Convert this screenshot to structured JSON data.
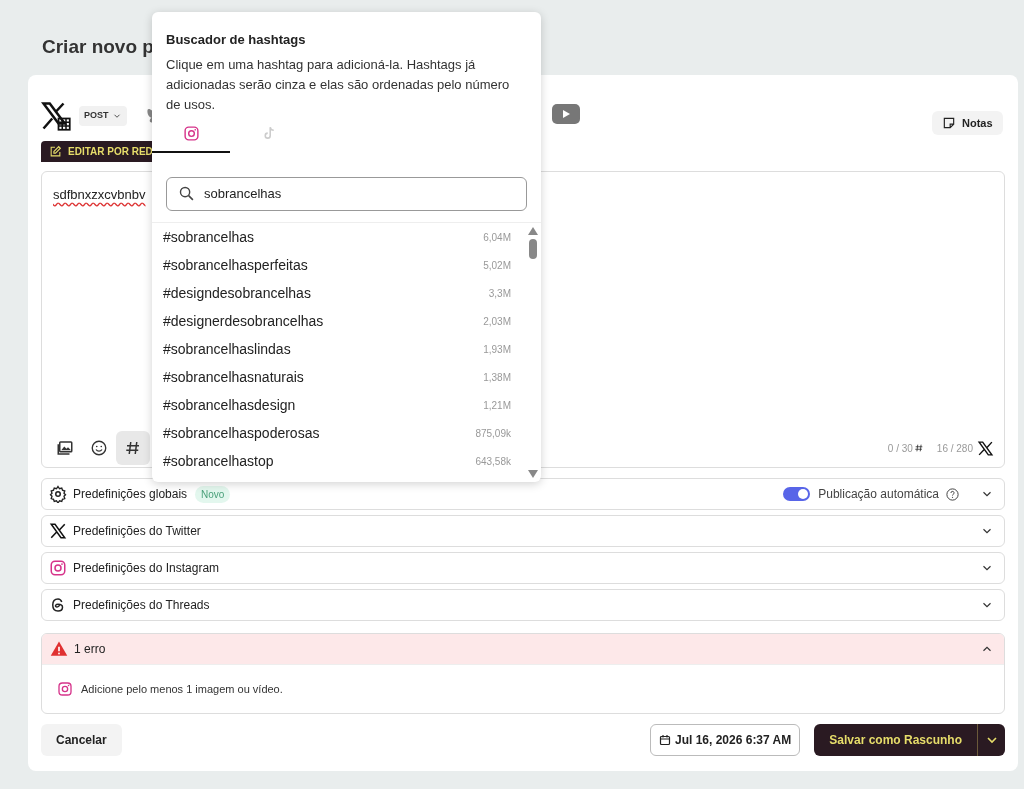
{
  "page_title": "Criar novo p",
  "platforms": {
    "post_type": "POST"
  },
  "edit_by_network": "EDITAR POR RED",
  "notes_button": "Notas",
  "editor": {
    "text": "sdfbnxzxcvbnbv",
    "tools": [
      {
        "kind": "media",
        "active": false
      },
      {
        "kind": "emoji",
        "active": false
      },
      {
        "kind": "hashtag",
        "active": true
      }
    ],
    "hashtag_count": "0 / 30",
    "char_count": "16 / 280"
  },
  "presets": [
    {
      "kind": "global",
      "label": "Predefinições globais",
      "badge": "Novo",
      "auto_publish": {
        "label": "Publicação automática",
        "on": true
      },
      "expanded": false
    },
    {
      "kind": "twitter",
      "label": "Predefinições do Twitter",
      "expanded": false
    },
    {
      "kind": "instagram",
      "label": "Predefinições do Instagram",
      "expanded": false
    },
    {
      "kind": "threads",
      "label": "Predefinições do Threads",
      "expanded": false
    }
  ],
  "errors": {
    "title": "1 erro",
    "expanded": true,
    "items": [
      {
        "kind": "instagram",
        "text": "Adicione pelo menos 1 imagem ou vídeo."
      }
    ]
  },
  "footer": {
    "cancel": "Cancelar",
    "date": "Jul 16, 2026 6:37 AM",
    "save": "Salvar como Rascunho"
  },
  "hashtag_finder": {
    "title": "Buscador de hashtags",
    "description": "Clique em uma hashtag para adicioná-la. Hashtags já adicionadas serão cinza e elas são ordenadas pelo número de usos.",
    "tabs": [
      {
        "kind": "instagram",
        "selected": true
      },
      {
        "kind": "tiktok",
        "selected": false
      }
    ],
    "search": {
      "value": "sobrancelhas"
    },
    "results": [
      {
        "tag": "#sobrancelhas",
        "uses": "6,04M",
        "added": false
      },
      {
        "tag": "#sobrancelhasperfeitas",
        "uses": "5,02M",
        "added": false
      },
      {
        "tag": "#designdesobrancelhas",
        "uses": "3,3M",
        "added": false
      },
      {
        "tag": "#designerdesobrancelhas",
        "uses": "2,03M",
        "added": false
      },
      {
        "tag": "#sobrancelhaslindas",
        "uses": "1,93M",
        "added": false
      },
      {
        "tag": "#sobrancelhasnaturais",
        "uses": "1,38M",
        "added": false
      },
      {
        "tag": "#sobrancelhasdesign",
        "uses": "1,21M",
        "added": false
      },
      {
        "tag": "#sobrancelhaspoderosas",
        "uses": "875,09k",
        "added": false
      },
      {
        "tag": "#sobrancelhastop",
        "uses": "643,58k",
        "added": false
      }
    ]
  }
}
